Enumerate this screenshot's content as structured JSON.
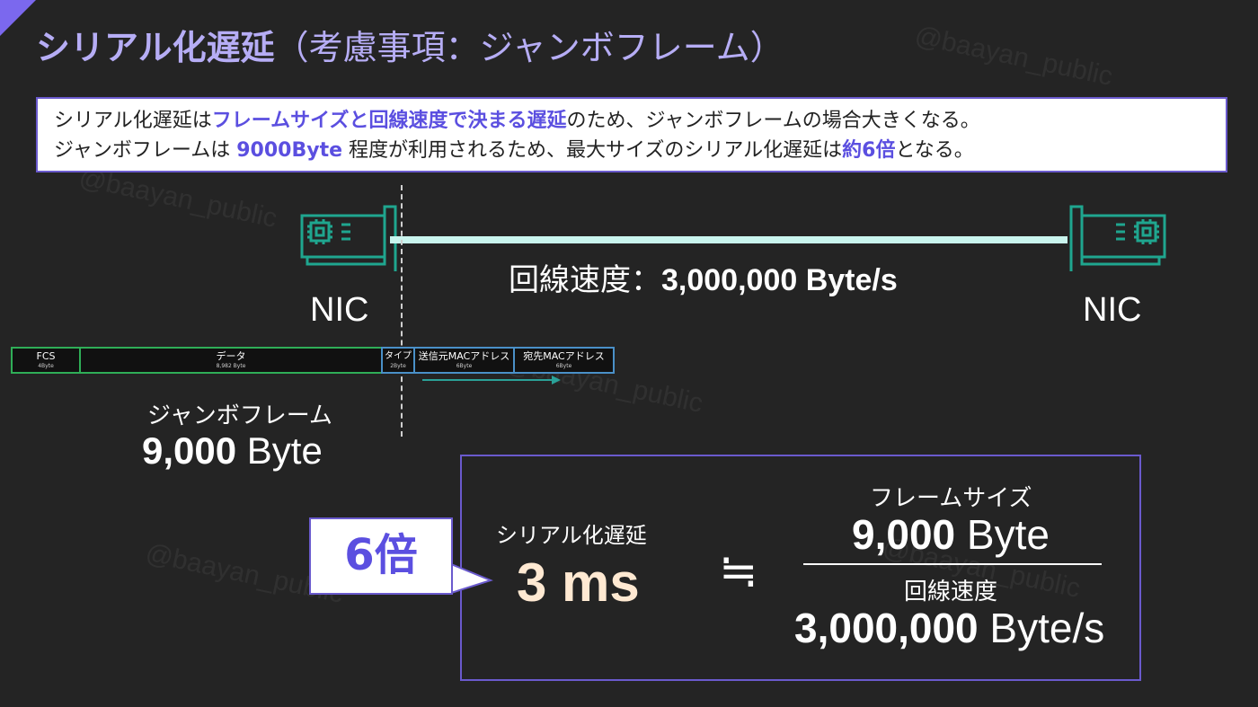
{
  "title": {
    "main": "シリアル化遅延",
    "sub": "（考慮事項：ジャンボフレーム）"
  },
  "watermark": "@baayan_public",
  "note": {
    "line1": [
      "シリアル化遅延は",
      "フレームサイズと回線速度で決まる遅延",
      "のため、ジャンボフレームの場合大きくなる。"
    ],
    "line2": [
      "ジャンボフレームは ",
      "9000Byte",
      " 程度が利用されるため、最大サイズのシリアル化遅延は",
      "約6倍",
      "となる。"
    ]
  },
  "nic": {
    "left_label": "NIC",
    "right_label": "NIC"
  },
  "link": {
    "label": "回線速度：",
    "value": "3,000,000 Byte/s"
  },
  "frame_fields": [
    {
      "name": "FCS",
      "size": "4Byte"
    },
    {
      "name": "データ",
      "size": "8,982 Byte"
    },
    {
      "name": "タイプ",
      "size": "2Byte"
    },
    {
      "name": "送信元MACアドレス",
      "size": "6Byte"
    },
    {
      "name": "宛先MACアドレス",
      "size": "6Byte"
    }
  ],
  "jumbo": {
    "label": "ジャンボフレーム",
    "size_number": "9,000",
    "size_unit": " Byte"
  },
  "callout": "6倍",
  "serialization": {
    "label": "シリアル化遅延",
    "value": "3 ms"
  },
  "formula": {
    "approx_symbol": "≒",
    "numerator_label": "フレームサイズ",
    "numerator_number": "9,000",
    "numerator_unit": " Byte",
    "denominator_label": "回線速度",
    "denominator_number": "3,000,000",
    "denominator_unit": " Byte/s"
  },
  "colors": {
    "background": "#242424",
    "accent": "#6a5acd",
    "highlight": "#5b4fe0",
    "nic_icon": "#1fa68f",
    "link_line": "#c9f5ee",
    "data_field_border": "#2fae57",
    "header_field_border": "#4a90c8"
  },
  "icons": {
    "nic": "network-interface-card-icon"
  }
}
